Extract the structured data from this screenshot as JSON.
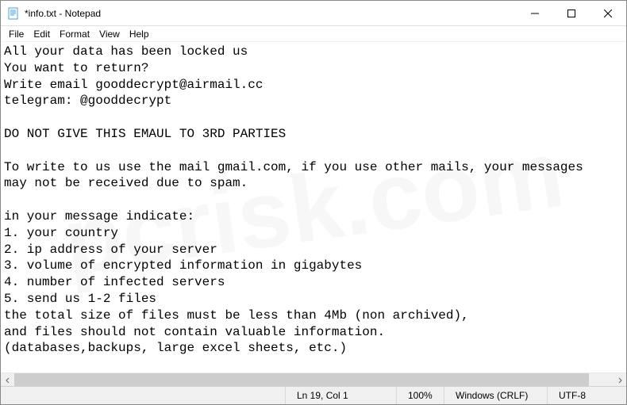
{
  "window": {
    "title": "*info.txt - Notepad"
  },
  "menus": {
    "file": "File",
    "edit": "Edit",
    "format": "Format",
    "view": "View",
    "help": "Help"
  },
  "editor": {
    "content": "All your data has been locked us\nYou want to return?\nWrite email gooddecrypt@airmail.cc\ntelegram: @gooddecrypt\n\nDO NOT GIVE THIS EMAUL TO 3RD PARTIES\n\nTo write to us use the mail gmail.com, if you use other mails, your messages\nmay not be received due to spam.\n\nin your message indicate:\n1. your country\n2. ip address of your server\n3. volume of encrypted information in gigabytes\n4. number of infected servers\n5. send us 1-2 files\nthe total size of files must be less than 4Mb (non archived),\nand files should not contain valuable information.\n(databases,backups, large excel sheets, etc.)"
  },
  "statusbar": {
    "position": "Ln 19, Col 1",
    "zoom": "100%",
    "lineending": "Windows (CRLF)",
    "encoding": "UTF-8"
  }
}
